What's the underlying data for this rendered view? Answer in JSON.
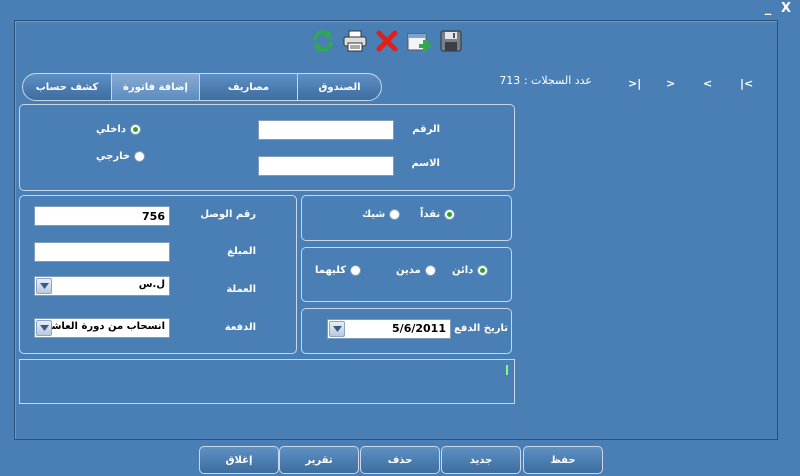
{
  "window": {
    "minimize_label": "_",
    "close_label": "X"
  },
  "toolbar": {
    "icons": [
      "refresh-icon",
      "print-icon",
      "delete-icon",
      "new-record-icon",
      "save-disk-icon"
    ]
  },
  "tabs": [
    {
      "label": "الصندوق"
    },
    {
      "label": "مصاريف"
    },
    {
      "label": "إضافة فاتورة",
      "active": true
    },
    {
      "label": "كشف حساب"
    }
  ],
  "records": {
    "label": "عدد السجلات :",
    "count": "713"
  },
  "nav": {
    "first": ">|",
    "prev": ">",
    "next": "<",
    "last": "|<"
  },
  "identity": {
    "number_label": "الرقم",
    "number_value": "",
    "name_label": "الاسم",
    "name_value": "",
    "internal_label": "داخلي",
    "external_label": "خارجي"
  },
  "payment_type": {
    "cash_label": "نقداً",
    "cheque_label": "شيك"
  },
  "balance_type": {
    "creditor_label": "دائن",
    "debtor_label": "مدين",
    "both_label": "كليهما"
  },
  "payment_date": {
    "label": "تاريخ الدفع",
    "value": "5/6/2011"
  },
  "receipt": {
    "number_label": "رقم الوصل",
    "number_value": "756",
    "amount_label": "المبلغ",
    "amount_value": "",
    "currency_label": "العملة",
    "currency_value": "ل.س",
    "installment_label": "الدفعة",
    "installment_value": "انسحاب من دورة العاشر"
  },
  "buttons": {
    "save": "حفظ",
    "new": "جديد",
    "delete": "حذف",
    "report": "تقرير",
    "close": "إغلاق"
  },
  "colors": {
    "background": "#4a7fb5",
    "border": "#c9d7e8",
    "selected_radio": "#2ea02e"
  }
}
